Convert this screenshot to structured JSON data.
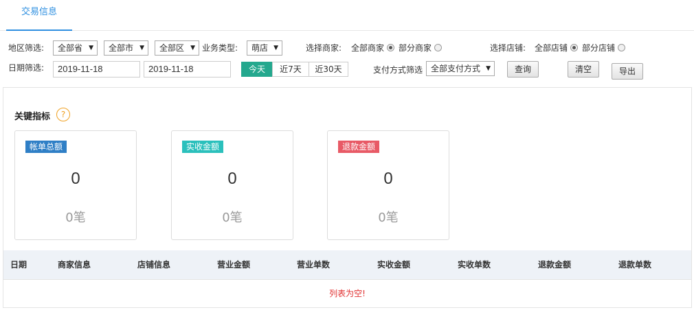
{
  "tabs": [
    {
      "label": "交易信息",
      "active": true
    }
  ],
  "filters": {
    "region_label": "地区筛选:",
    "province": "全部省",
    "city": "全部市",
    "district": "全部区",
    "business_type_label": "业务类型:",
    "business_type": "萌店",
    "merchant_label": "选择商家:",
    "merchant_options": [
      {
        "label": "全部商家",
        "checked": true
      },
      {
        "label": "部分商家",
        "checked": false
      }
    ],
    "store_label": "选择店铺:",
    "store_options": [
      {
        "label": "全部店铺",
        "checked": true
      },
      {
        "label": "部分店铺",
        "checked": false
      }
    ],
    "date_label": "日期筛选:",
    "date_start": "2019-11-18",
    "date_end": "2019-11-18",
    "quick_ranges": [
      {
        "label": "今天",
        "active": true
      },
      {
        "label": "近7天",
        "active": false
      },
      {
        "label": "近30天",
        "active": false
      }
    ],
    "payment_label": "支付方式筛选",
    "payment_method": "全部支付方式",
    "query_label": "查询",
    "clear_label": "清空",
    "export_label": "导出"
  },
  "kpi": {
    "title": "关键指标",
    "help_glyph": "?",
    "cards": [
      {
        "label": "帐单总额",
        "value": "0",
        "count": "0笔",
        "color": "#2f7fc6"
      },
      {
        "label": "实收金额",
        "value": "0",
        "count": "0笔",
        "color": "#2bc0bc"
      },
      {
        "label": "退款金额",
        "value": "0",
        "count": "0笔",
        "color": "#e85a66"
      }
    ]
  },
  "table": {
    "columns": [
      "日期",
      "商家信息",
      "店铺信息",
      "营业金额",
      "营业单数",
      "实收金额",
      "实收单数",
      "退款金额",
      "退款单数"
    ],
    "empty_text": "列表为空!"
  },
  "colors": {
    "accent": "#2e8fe0",
    "today_active": "#24a88e",
    "empty_text": "#e03030",
    "help": "#f0a020"
  }
}
